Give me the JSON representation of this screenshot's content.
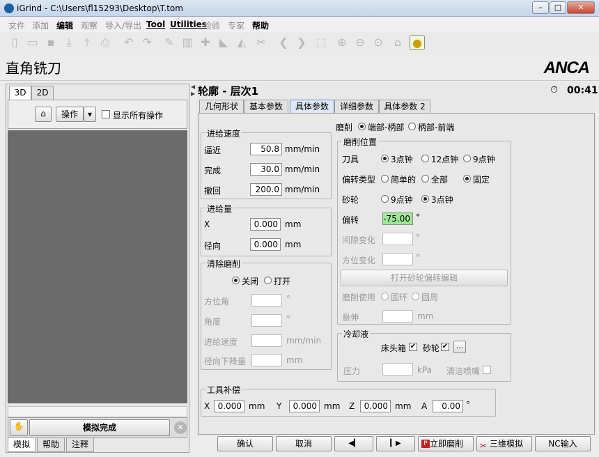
{
  "window": {
    "title": "iGrind - C:\\Users\\fl15293\\Desktop\\T.tom",
    "min": "–",
    "max": "□",
    "close": "✕"
  },
  "menu": [
    "文件",
    "添加",
    "编辑",
    "观察",
    "导入/导出",
    "Tool",
    "Utilities",
    "检验",
    "专家",
    "帮助"
  ],
  "page_title": "直角铣刀",
  "brand": "ANCA",
  "left": {
    "tab_3d": "3D",
    "tab_2d": "2D",
    "ops_label": "操作",
    "show_all": "显示所有操作",
    "sim_done": "模拟完成",
    "bottom_tabs": [
      "模拟",
      "帮助",
      "注释"
    ]
  },
  "right": {
    "title": "轮廓 - 层次1",
    "timer": "00:41",
    "tabs": [
      "几何形状",
      "基本参数",
      "具体参数",
      "详细参数",
      "具体参数 2"
    ]
  },
  "feed": {
    "title": "进给速度",
    "rows": [
      {
        "label": "逼近",
        "value": "50.8",
        "unit": "mm/min"
      },
      {
        "label": "完成",
        "value": "30.0",
        "unit": "mm/min"
      },
      {
        "label": "撤回",
        "value": "200.0",
        "unit": "mm/min"
      }
    ]
  },
  "infeed": {
    "title": "进给量",
    "rows": [
      {
        "label": "X",
        "value": "0.000",
        "unit": "mm"
      },
      {
        "label": "径向",
        "value": "0.000",
        "unit": "mm"
      }
    ]
  },
  "clear": {
    "title": "清除磨削",
    "off": "关闭",
    "on": "打开",
    "rows": [
      {
        "label": "方位角",
        "unit": "°"
      },
      {
        "label": "角度",
        "unit": "°"
      },
      {
        "label": "进给速度",
        "unit": "mm/min"
      },
      {
        "label": "径向下降量",
        "unit": "mm"
      }
    ]
  },
  "grind": {
    "label": "磨削",
    "opt1": "端部-柄部",
    "opt2": "柄部-前端"
  },
  "pos": {
    "title": "磨削位置",
    "tool": "刀具",
    "tool_opts": [
      "3点钟",
      "12点钟",
      "9点钟"
    ],
    "offset_type": "偏转类型",
    "offset_opts": [
      "简单的",
      "全部",
      "固定"
    ],
    "wheel": "砂轮",
    "wheel_opts": [
      "9点钟",
      "3点钟"
    ],
    "offset": "偏转",
    "offset_value": "-75.00",
    "offset_unit": "°",
    "gap": "间隙变化",
    "gap_unit": "°",
    "az": "方位变化",
    "az_unit": "°",
    "open_btn": "打开砂轮偏转编辑",
    "use": "磨削使用",
    "use_opts": [
      "圆环",
      "圆周"
    ],
    "overhang": "悬伸",
    "overhang_unit": "mm"
  },
  "coolant": {
    "title": "冷却液",
    "headstock": "床头箱",
    "wheel": "砂轮",
    "more": "...",
    "pressure": "压力",
    "pressure_unit": "kPa",
    "nozzle": "清洁喷嘴"
  },
  "comp": {
    "title": "工具补偿",
    "items": [
      {
        "label": "X",
        "value": "0.000",
        "unit": "mm"
      },
      {
        "label": "Y",
        "value": "0.000",
        "unit": "mm"
      },
      {
        "label": "Z",
        "value": "0.000",
        "unit": "mm"
      },
      {
        "label": "A",
        "value": "0.00",
        "unit": "°"
      }
    ]
  },
  "bottom": {
    "ok": "确认",
    "cancel": "取消",
    "prev": "◀▎",
    "next": "▎▶",
    "grind_now": "立即磨削",
    "sim3d": "三维模拟",
    "nc": "NC输入"
  }
}
